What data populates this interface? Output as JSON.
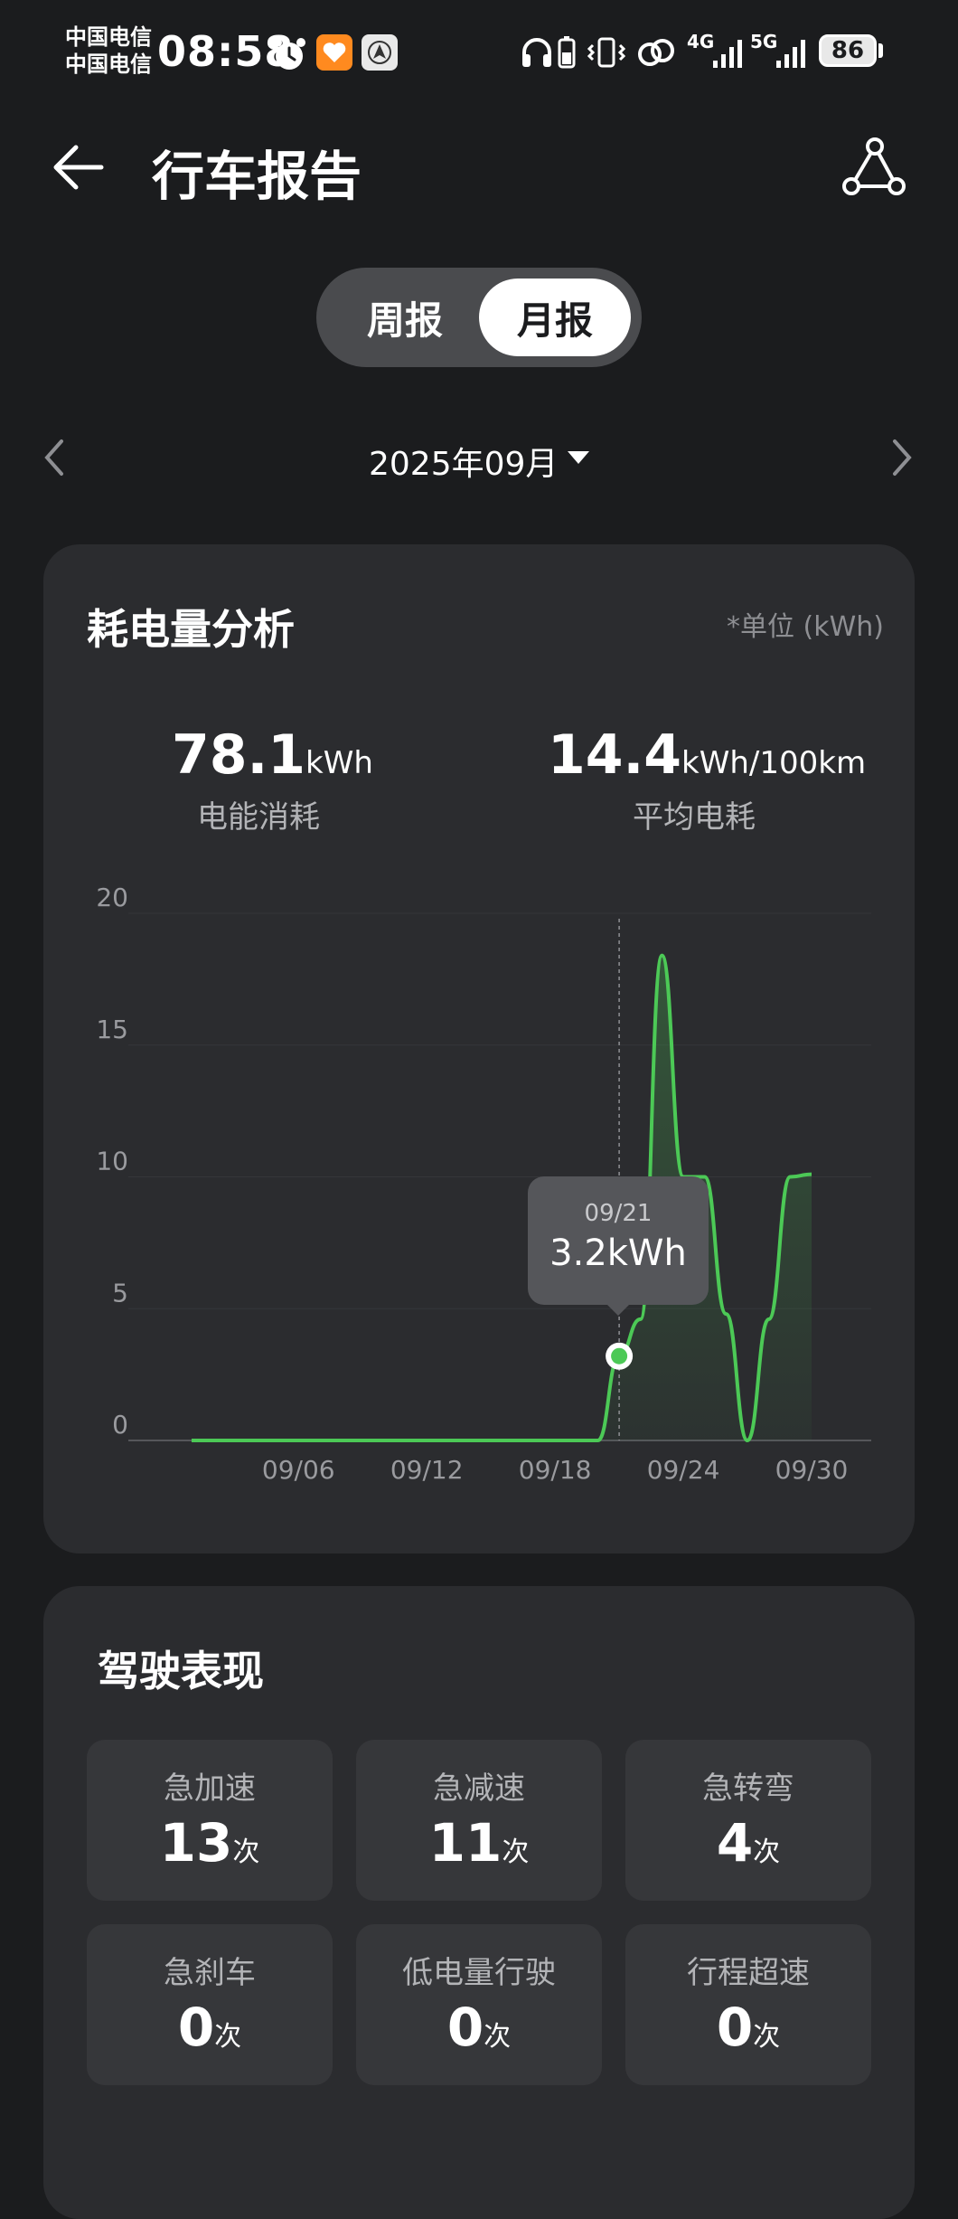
{
  "status_bar": {
    "carrier_1": "中国电信",
    "carrier_2": "中国电信",
    "time": "08:58",
    "network_1": "4G",
    "network_2": "5G",
    "battery": "86"
  },
  "header": {
    "title": "行车报告",
    "back_icon": "arrow-left-icon",
    "share_icon": "share-icon"
  },
  "period_toggle": {
    "week": "周报",
    "month": "月报",
    "selected": "month"
  },
  "month_selector": {
    "label": "2025年09月"
  },
  "energy_card": {
    "title": "耗电量分析",
    "unit_note": "*单位 (kWh)",
    "total_value": "78.1",
    "total_unit": "kWh",
    "total_label": "电能消耗",
    "avg_value": "14.4",
    "avg_unit": "kWh/100km",
    "avg_label": "平均电耗",
    "tooltip_date": "09/21",
    "tooltip_value": "3.2kWh"
  },
  "chart_data": {
    "type": "area",
    "ylim": [
      0,
      20
    ],
    "y_ticks": [
      "20",
      "15",
      "10",
      "5",
      "0"
    ],
    "x_ticks": [
      "09/06",
      "09/12",
      "09/18",
      "09/24",
      "09/30"
    ],
    "x_range": [
      "09/01",
      "09/30"
    ],
    "grid": true,
    "line_color": "#4cc956",
    "points": [
      {
        "x": "09/01",
        "y": 0
      },
      {
        "x": "09/02",
        "y": 0
      },
      {
        "x": "09/03",
        "y": 0
      },
      {
        "x": "09/04",
        "y": 0
      },
      {
        "x": "09/05",
        "y": 0
      },
      {
        "x": "09/06",
        "y": 0
      },
      {
        "x": "09/07",
        "y": 0
      },
      {
        "x": "09/08",
        "y": 0
      },
      {
        "x": "09/09",
        "y": 0
      },
      {
        "x": "09/10",
        "y": 0
      },
      {
        "x": "09/11",
        "y": 0
      },
      {
        "x": "09/12",
        "y": 0
      },
      {
        "x": "09/13",
        "y": 0
      },
      {
        "x": "09/14",
        "y": 0
      },
      {
        "x": "09/15",
        "y": 0
      },
      {
        "x": "09/16",
        "y": 0
      },
      {
        "x": "09/17",
        "y": 0
      },
      {
        "x": "09/18",
        "y": 0
      },
      {
        "x": "09/19",
        "y": 0
      },
      {
        "x": "09/20",
        "y": 0
      },
      {
        "x": "09/21",
        "y": 3.2
      },
      {
        "x": "09/22",
        "y": 4.6
      },
      {
        "x": "09/23",
        "y": 18.4
      },
      {
        "x": "09/24",
        "y": 10
      },
      {
        "x": "09/25",
        "y": 10
      },
      {
        "x": "09/26",
        "y": 4.8
      },
      {
        "x": "09/27",
        "y": 0
      },
      {
        "x": "09/28",
        "y": 4.6
      },
      {
        "x": "09/29",
        "y": 10
      },
      {
        "x": "09/30",
        "y": 10.1
      }
    ],
    "highlight": {
      "x": "09/21",
      "y": 3.2
    }
  },
  "driving_card": {
    "title": "驾驶表现",
    "unit": "次",
    "metrics": [
      {
        "label": "急加速",
        "value": "13"
      },
      {
        "label": "急减速",
        "value": "11"
      },
      {
        "label": "急转弯",
        "value": "4"
      },
      {
        "label": "急刹车",
        "value": "0"
      },
      {
        "label": "低电量行驶",
        "value": "0"
      },
      {
        "label": "行程超速",
        "value": "0"
      }
    ]
  }
}
